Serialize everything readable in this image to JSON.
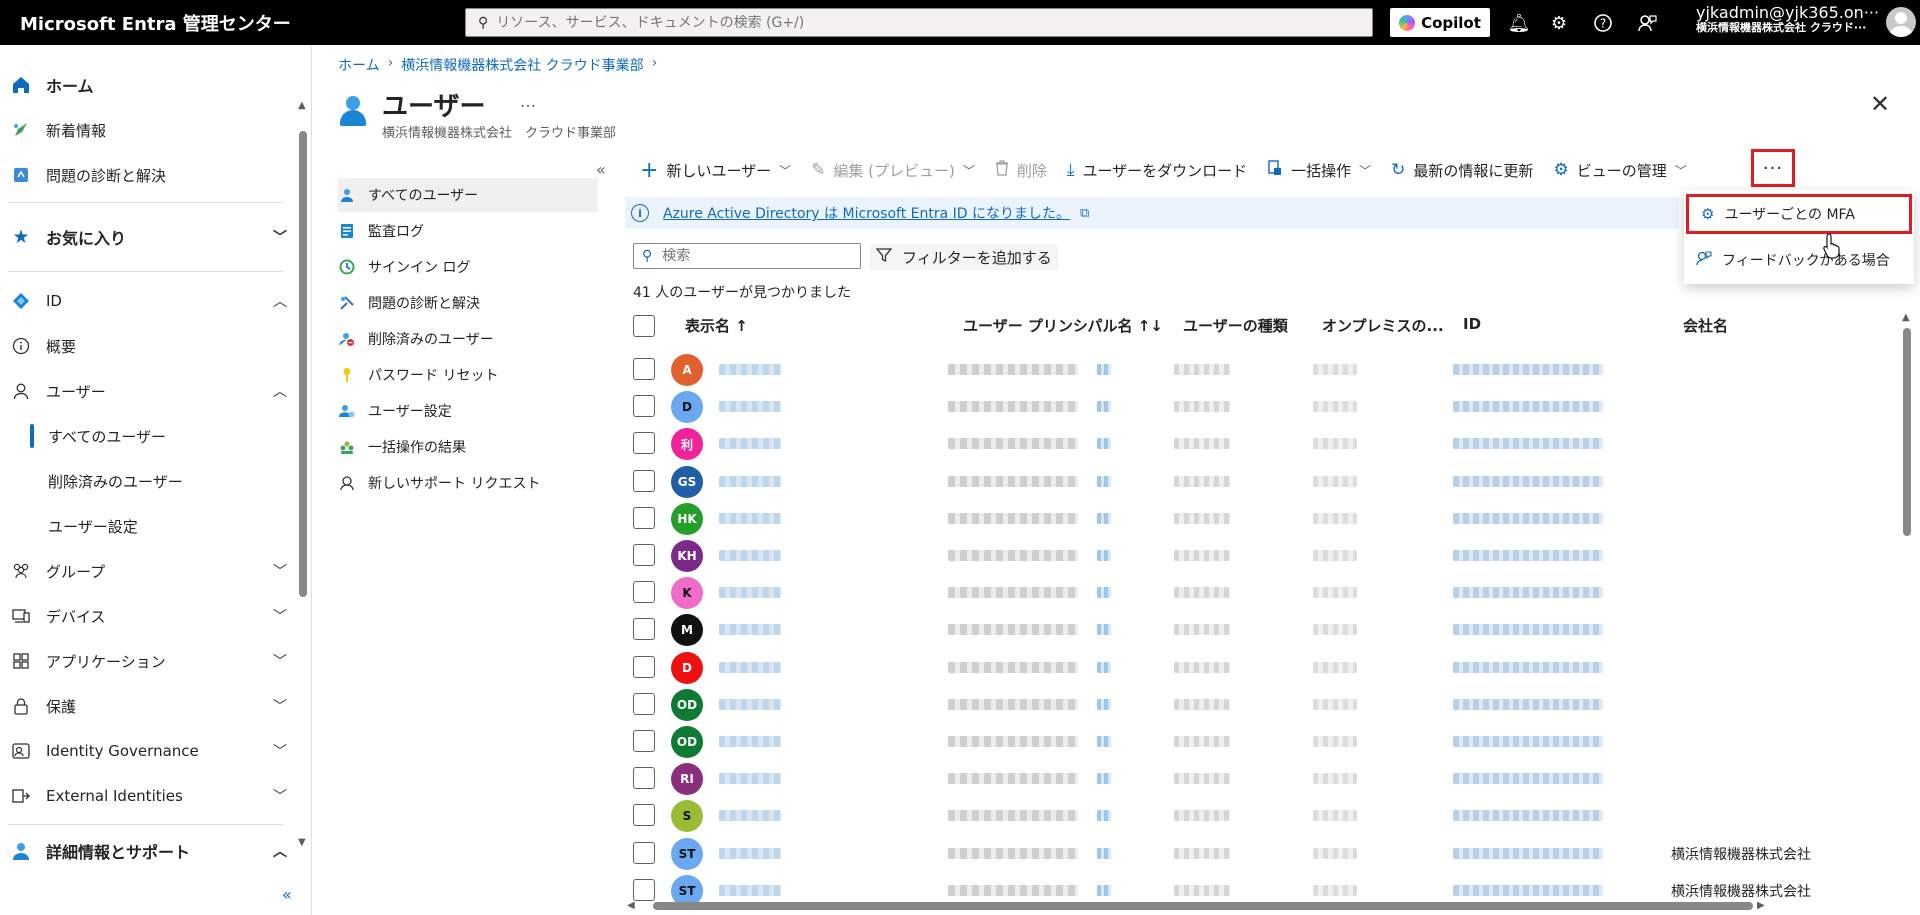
{
  "app": {
    "title": "Microsoft Entra 管理センター",
    "search_placeholder": "リソース、サービス、ドキュメントの検索 (G+/)",
    "copilot_label": "Copilot",
    "user_upn": "yjkadmin@yjk365.on···",
    "user_org": "横浜情報機器株式会社 クラウド···"
  },
  "leftnav": {
    "home": "ホーム",
    "whats_new": "新着情報",
    "diagnose": "問題の診断と解決",
    "favorites": "お気に入り",
    "id": "ID",
    "overview": "概要",
    "users": "ユーザー",
    "all_users": "すべてのユーザー",
    "deleted_users": "削除済みのユーザー",
    "user_settings": "ユーザー設定",
    "groups": "グループ",
    "devices": "デバイス",
    "applications": "アプリケーション",
    "protection": "保護",
    "identity_governance": "Identity Governance",
    "external_identities": "External Identities",
    "learn_support": "詳細情報とサポート"
  },
  "breadcrumb": {
    "home": "ホーム",
    "tenant": "横浜情報機器株式会社 クラウド事業部"
  },
  "page": {
    "title": "ユーザー",
    "subtitle": "横浜情報機器株式会社　クラウド事業部",
    "more": "…"
  },
  "subnav": {
    "all_users": "すべてのユーザー",
    "audit_logs": "監査ログ",
    "signin_logs": "サインイン ログ",
    "diagnose": "問題の診断と解決",
    "deleted_users": "削除済みのユーザー",
    "password_reset": "パスワード リセット",
    "user_settings": "ユーザー設定",
    "bulk_results": "一括操作の結果",
    "new_support": "新しいサポート リクエスト"
  },
  "toolbar": {
    "new_user": "新しいユーザー",
    "edit": "編集 (プレビュー)",
    "delete": "削除",
    "download": "ユーザーをダウンロード",
    "bulk": "一括操作",
    "refresh": "最新の情報に更新",
    "manage_view": "ビューの管理",
    "more": "···"
  },
  "banner": {
    "text": "Azure Active Directory は Microsoft Entra ID になりました。"
  },
  "dropdown": {
    "per_user_mfa": "ユーザーごとの MFA",
    "feedback": "フィードバックがある場合"
  },
  "filters": {
    "search_placeholder": "検索",
    "add_filter": "フィルターを追加する",
    "count": "41 人のユーザーが見つかりました"
  },
  "table": {
    "columns": [
      "表示名 ↑",
      "ユーザー プリンシパル名 ↑↓",
      "ユーザーの種類",
      "オンプレミスの...",
      "ID",
      "会社名"
    ],
    "rows": [
      {
        "initials": "A",
        "color": "#e06030",
        "company": ""
      },
      {
        "initials": "D",
        "color": "#6aa8f0",
        "company": ""
      },
      {
        "initials": "利",
        "color": "#f0239a",
        "company": ""
      },
      {
        "initials": "GS",
        "color": "#215ea8",
        "company": ""
      },
      {
        "initials": "HK",
        "color": "#22a02a",
        "company": ""
      },
      {
        "initials": "KH",
        "color": "#7b2a8a",
        "company": ""
      },
      {
        "initials": "K",
        "color": "#f06cc8",
        "company": ""
      },
      {
        "initials": "M",
        "color": "#111111",
        "company": ""
      },
      {
        "initials": "D",
        "color": "#ee1111",
        "company": ""
      },
      {
        "initials": "OD",
        "color": "#0e7a34",
        "company": ""
      },
      {
        "initials": "OD",
        "color": "#0e7a34",
        "company": ""
      },
      {
        "initials": "RI",
        "color": "#8b2f7b",
        "company": ""
      },
      {
        "initials": "S",
        "color": "#9cbb35",
        "company": ""
      },
      {
        "initials": "ST",
        "color": "#6aa8f0",
        "company": "横浜情報機器株式会社"
      },
      {
        "initials": "ST",
        "color": "#6aa8f0",
        "company": "横浜情報機器株式会社"
      }
    ]
  }
}
